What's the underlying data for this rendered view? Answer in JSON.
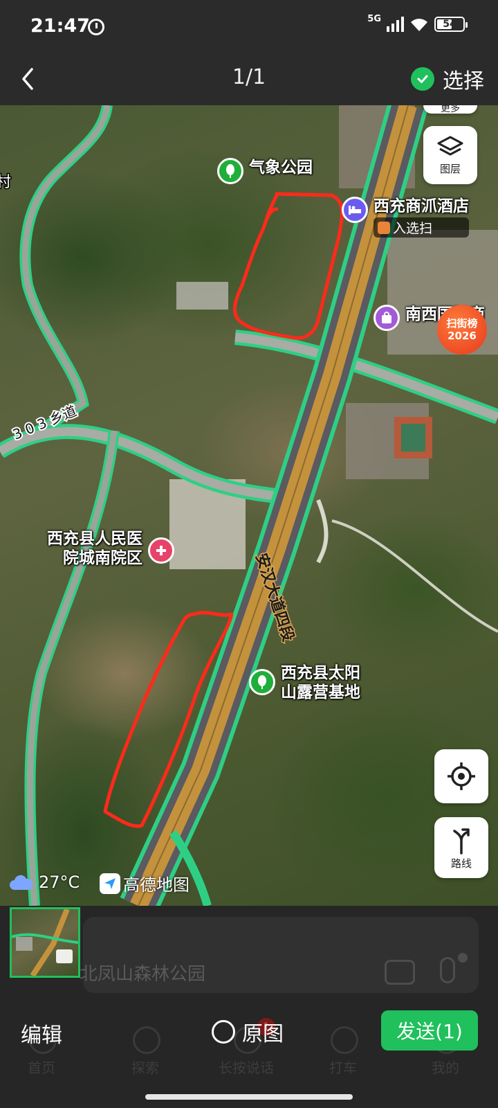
{
  "status_bar": {
    "time": "21:47",
    "network": "5G",
    "battery": "54",
    "battery_fraction": 0.54
  },
  "header": {
    "page_counter": "1/1",
    "select_label": "选择"
  },
  "map": {
    "pois": [
      {
        "label": "气象公园",
        "icon": "park-icon",
        "color": "#1fae3a"
      },
      {
        "label": "西充商沠酒店",
        "icon": "hotel-icon",
        "color": "#6b5cf0"
      },
      {
        "label": "南西国际商",
        "icon": "shopping-icon",
        "color": "#a35ad8"
      },
      {
        "label": "西充县人民医\n院城南院区",
        "icon": "hospital-icon",
        "color": "#e8426a"
      },
      {
        "label": "西充县太阳\n山露营基地",
        "icon": "camp-icon",
        "color": "#1fae3a"
      }
    ],
    "poi_sublabel": "入选扫",
    "partial_label_left": "村",
    "road_labels": {
      "rural_road": "3 0 3 乡道",
      "highway": "安汉大道四段"
    },
    "more_label": "更多",
    "layers_label": "图层",
    "route_label": "路线",
    "street_badge": {
      "line1": "扫街榜",
      "line2": "2026"
    },
    "weather": {
      "temperature": "27°C",
      "icon": "cloud-icon"
    },
    "brand": "高德地图",
    "annotation_color": "#ff2a1a"
  },
  "background_app": {
    "search_text": "北凤山森林公园",
    "tabs": [
      "首页",
      "探索",
      "长按说话",
      "打车",
      "我的"
    ],
    "badge_count": "1"
  },
  "bottom_bar": {
    "edit_label": "编辑",
    "original_label": "原图",
    "send_label": "发送(1)"
  }
}
